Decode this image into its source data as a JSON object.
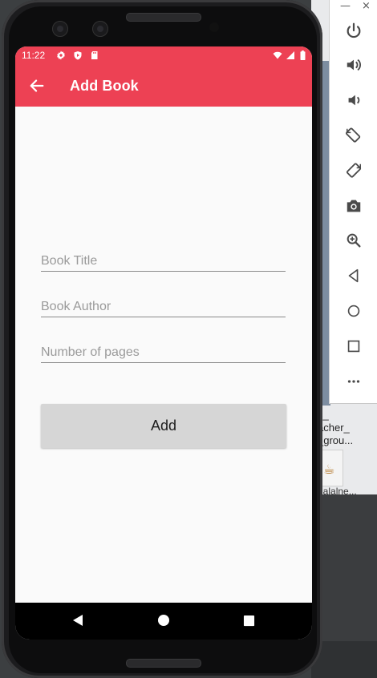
{
  "status_bar": {
    "time": "11:22",
    "icons": [
      "settings-icon",
      "shield-icon",
      "sd-card-icon",
      "wifi-icon",
      "signal-icon",
      "battery-icon"
    ]
  },
  "app_bar": {
    "title": "Add Book",
    "back_icon": "arrow-left-icon"
  },
  "form": {
    "book_title": {
      "value": "",
      "placeholder": "Book Title"
    },
    "book_author": {
      "value": "",
      "placeholder": "Book Author"
    },
    "pages": {
      "value": "",
      "placeholder": "Number of pages"
    },
    "add_label": "Add"
  },
  "navigation_bar": {
    "buttons": [
      "back-triangle-icon",
      "home-circle-icon",
      "recents-square-icon"
    ]
  },
  "emulator_toolbar": {
    "window_controls": [
      "—",
      "×"
    ],
    "buttons": [
      "power-icon",
      "volume-up-icon",
      "volume-down-icon",
      "rotate-left-icon",
      "rotate-right-icon",
      "camera-icon",
      "zoom-icon",
      "back-icon",
      "home-icon",
      "overview-icon",
      "more-icon"
    ]
  },
  "desktop": {
    "label_line1": "c_",
    "label_line2": "acher_",
    "label_line3": "_grou...",
    "file_label": "dalalne..."
  },
  "colors": {
    "app_bar": "#ed4154",
    "button": "#d6d6d6",
    "background": "#fafafa"
  }
}
